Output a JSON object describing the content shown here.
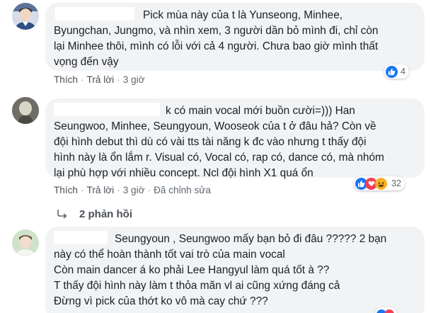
{
  "comments": [
    {
      "lines": [
        "Pick mùa này của t là Yunseong, Minhee,",
        "Byungchan, Jungmo, và nhìn xem, 3 người dần bỏ mình đi, chỉ còn",
        "lại Minhee thôi, mình có lỗi với cả 4 người. Chưa bao giờ mình thất",
        "vọng đến vậy"
      ],
      "like_label": "Thích",
      "reply_label": "Trả lời",
      "time": "3 giờ",
      "reaction_count": "4",
      "reactions": [
        "like-icon"
      ]
    },
    {
      "lines": [
        "k có main vocal mới buồn cười=))) Han",
        "Seungwoo, Minhee, Seungyoun, Wooseok của t ở đâu hả? Còn về",
        "đội hình debut thì dù có vài tts tài năng k đc vào nhưng t thấy đội",
        "hình này là ổn lắm r. Visual có, Vocal có, rap có, dance có, mà nhóm",
        "lại phù hợp với nhiều concept. Ncl đội hình X1 quá ổn"
      ],
      "like_label": "Thích",
      "reply_label": "Trả lời",
      "time": "3 giờ",
      "edited": "Đã chỉnh sửa",
      "reaction_count": "32",
      "reactions": [
        "like-icon",
        "love-icon",
        "haha-icon"
      ],
      "replies_label": "2 phản hồi"
    },
    {
      "lines": [
        "Seungyoun , Seungwoo mấy bạn bỏ đi đâu ????? 2 bạn",
        "này có thể hoàn thành tốt vai trò của main vocal",
        "Còn main dancer á ko phải Lee Hangyul làm quá tốt à ??",
        "T thấy đội hình này làm t thỏa mãn vl ai cũng xứng đáng cả",
        "Đừng vì pick của thớt ko vô mà cay chứ ???"
      ]
    }
  ],
  "colors": {
    "bubble": "#f2f3f5",
    "link": "#4b4f56",
    "meta": "#606770",
    "like": "#1877f2",
    "love": "#f33e58",
    "haha": "#f7b125"
  }
}
